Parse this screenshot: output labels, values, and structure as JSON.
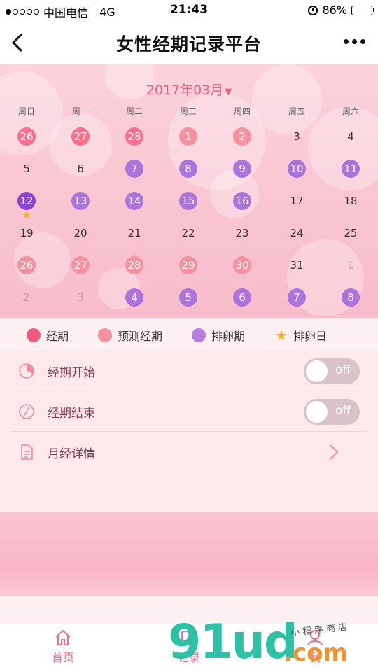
{
  "status_bar": {
    "carrier": "中国电信",
    "network": "4G",
    "time": "21:43",
    "battery": "86%",
    "battery_level": 0.86,
    "signal_bars_filled": 1,
    "signal_bars_total": 5
  },
  "nav": {
    "title": "女性经期记录平台",
    "back_icon": "chevron-left-icon",
    "more_icon": "more-dots-icon"
  },
  "calendar": {
    "month_label": "2017年03月",
    "weekdays": [
      "周日",
      "周一",
      "周二",
      "周三",
      "周四",
      "周五",
      "周六"
    ],
    "weeks": [
      [
        {
          "d": "26",
          "t": "period"
        },
        {
          "d": "27",
          "t": "period"
        },
        {
          "d": "28",
          "t": "period"
        },
        {
          "d": "1",
          "t": "predicted"
        },
        {
          "d": "2",
          "t": "predicted"
        },
        {
          "d": "3",
          "t": ""
        },
        {
          "d": "4",
          "t": ""
        }
      ],
      [
        {
          "d": "5",
          "t": ""
        },
        {
          "d": "6",
          "t": ""
        },
        {
          "d": "7",
          "t": "ovulation"
        },
        {
          "d": "8",
          "t": "ovulation"
        },
        {
          "d": "9",
          "t": "ovulation"
        },
        {
          "d": "10",
          "t": "ovulation"
        },
        {
          "d": "11",
          "t": "ovulation"
        }
      ],
      [
        {
          "d": "12",
          "t": "ovday",
          "star": true
        },
        {
          "d": "13",
          "t": "ovulation"
        },
        {
          "d": "14",
          "t": "ovulation"
        },
        {
          "d": "15",
          "t": "ovulation"
        },
        {
          "d": "16",
          "t": "ovulation"
        },
        {
          "d": "17",
          "t": ""
        },
        {
          "d": "18",
          "t": ""
        }
      ],
      [
        {
          "d": "19",
          "t": ""
        },
        {
          "d": "20",
          "t": ""
        },
        {
          "d": "21",
          "t": ""
        },
        {
          "d": "22",
          "t": ""
        },
        {
          "d": "23",
          "t": ""
        },
        {
          "d": "24",
          "t": ""
        },
        {
          "d": "25",
          "t": ""
        }
      ],
      [
        {
          "d": "26",
          "t": "predicted"
        },
        {
          "d": "27",
          "t": "predicted"
        },
        {
          "d": "28",
          "t": "predicted"
        },
        {
          "d": "29",
          "t": "predicted"
        },
        {
          "d": "30",
          "t": "predicted"
        },
        {
          "d": "31",
          "t": ""
        },
        {
          "d": "1",
          "t": "faded"
        }
      ],
      [
        {
          "d": "2",
          "t": "faded"
        },
        {
          "d": "3",
          "t": "faded"
        },
        {
          "d": "4",
          "t": "ovulation"
        },
        {
          "d": "5",
          "t": "ovulation"
        },
        {
          "d": "6",
          "t": "ovulation"
        },
        {
          "d": "7",
          "t": "ovulation"
        },
        {
          "d": "8",
          "t": "ovulation"
        }
      ]
    ]
  },
  "legend": [
    {
      "label": "经期",
      "color": "#f25b7a",
      "icon": "dot"
    },
    {
      "label": "预测经期",
      "color": "#f7909f",
      "icon": "dot"
    },
    {
      "label": "排卵期",
      "color": "#b47ddf",
      "icon": "dot"
    },
    {
      "label": "排卵日",
      "color": "#f6b21e",
      "icon": "star-icon"
    }
  ],
  "rows": [
    {
      "label": "经期开始",
      "icon": "pie-chart-icon",
      "toggle": "off"
    },
    {
      "label": "经期结束",
      "icon": "slash-circle-icon",
      "toggle": "off"
    },
    {
      "label": "月经详情",
      "icon": "document-icon",
      "chevron": "chevron-right-icon"
    }
  ],
  "tabs": [
    {
      "label": "首页",
      "icon": "home-icon"
    },
    {
      "label": "记录",
      "icon": "edit-icon"
    },
    {
      "label": "我",
      "icon": "user-icon"
    }
  ],
  "watermark": {
    "big": "91ud",
    "suffix": ".com",
    "handwriting": "小程序商店"
  },
  "colors": {
    "accent": "#ee5d84",
    "period": "#f5718d",
    "predicted": "#f7909f",
    "ovulation": "#ad73dc",
    "ovulation_day": "#8f45cf",
    "star": "#f6b21e"
  }
}
